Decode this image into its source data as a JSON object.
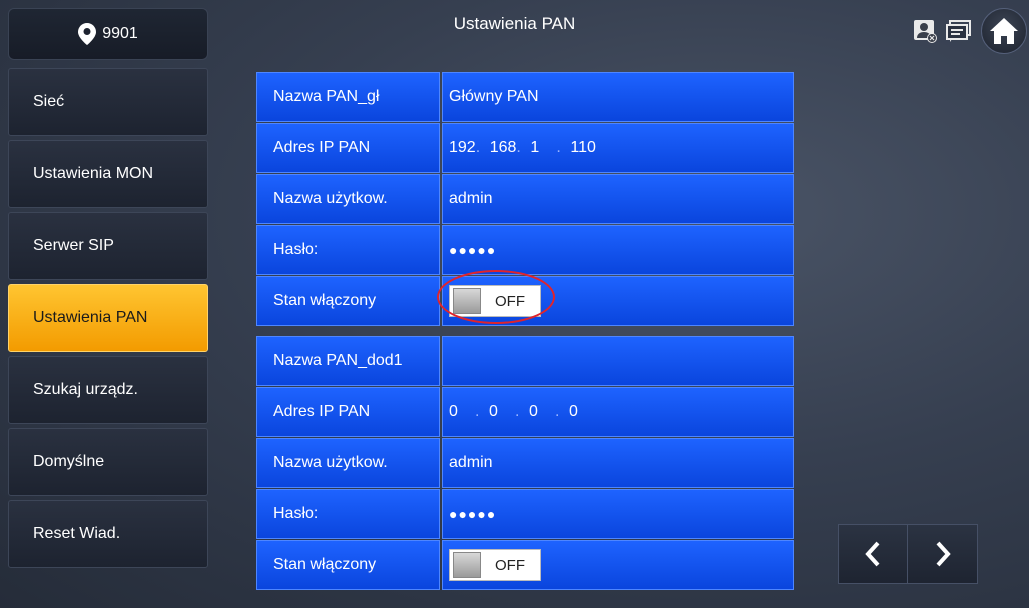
{
  "header": {
    "room_number": "9901",
    "title": "Ustawienia PAN",
    "icons": [
      "contact-card-icon",
      "message-icon",
      "home-icon"
    ]
  },
  "sidebar": {
    "items": [
      {
        "label": "Sieć",
        "active": false
      },
      {
        "label": "Ustawienia MON",
        "active": false
      },
      {
        "label": "Serwer SIP",
        "active": false
      },
      {
        "label": "Ustawienia PAN",
        "active": true
      },
      {
        "label": "Szukaj urządz.",
        "active": false
      },
      {
        "label": "Domyślne",
        "active": false
      },
      {
        "label": "Reset Wiad.",
        "active": false
      }
    ]
  },
  "form": {
    "main": {
      "name_label": "Nazwa PAN_gł",
      "name_value": "Główny PAN",
      "ip_label": "Adres IP PAN",
      "ip": [
        "192",
        "168",
        "1",
        "110"
      ],
      "user_label": "Nazwa użytkow.",
      "user_value": "admin",
      "password_label": "Hasło:",
      "password_value": "●●●●●",
      "enabled_label": "Stan włączony",
      "enabled_value": "OFF"
    },
    "secondary": {
      "name_label": "Nazwa PAN_dod1",
      "name_value": "",
      "ip_label": "Adres IP PAN",
      "ip": [
        "0",
        "0",
        "0",
        "0"
      ],
      "user_label": "Nazwa użytkow.",
      "user_value": "admin",
      "password_label": "Hasło:",
      "password_value": "●●●●●",
      "enabled_label": "Stan włączony",
      "enabled_value": "OFF"
    },
    "ip_separator": "."
  },
  "colors": {
    "field_blue": "#0a45dd",
    "active_tab": "#f39b00",
    "highlight_ring": "#e0242c"
  }
}
